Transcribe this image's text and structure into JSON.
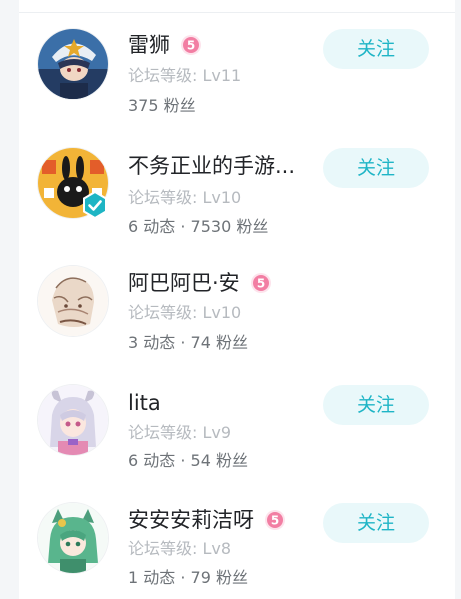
{
  "users": [
    {
      "name": "雷狮",
      "level": "论坛等级: Lv11",
      "stats": "375 粉丝",
      "badge_icon": "level-5-badge-icon",
      "has_badge": true,
      "verified": false,
      "follow_label": "关注",
      "show_follow": true
    },
    {
      "name": "不务正业的手游...",
      "level": "论坛等级: Lv10",
      "stats": "6 动态 · 7530 粉丝",
      "has_badge": false,
      "verified": true,
      "verified_icon": "verified-check-icon",
      "follow_label": "关注",
      "show_follow": true
    },
    {
      "name": "阿巴阿巴·安",
      "level": "论坛等级: Lv10",
      "stats": "3 动态 · 74 粉丝",
      "badge_icon": "level-5-badge-icon",
      "has_badge": true,
      "verified": false,
      "show_follow": false
    },
    {
      "name": "lita",
      "level": "论坛等级: Lv9",
      "stats": "6 动态 · 54 粉丝",
      "has_badge": false,
      "verified": false,
      "follow_label": "关注",
      "show_follow": true
    },
    {
      "name": "安安安莉洁呀",
      "level": "论坛等级: Lv8",
      "stats": "1 动态 · 79 粉丝",
      "badge_icon": "level-5-badge-icon",
      "has_badge": true,
      "verified": false,
      "follow_label": "关注",
      "show_follow": true
    }
  ],
  "colors": {
    "accent": "#1fb5c6",
    "follow_bg": "#e9f8fa",
    "badge_pink": "#f27ea3",
    "verified_teal": "#1eb5c4"
  }
}
